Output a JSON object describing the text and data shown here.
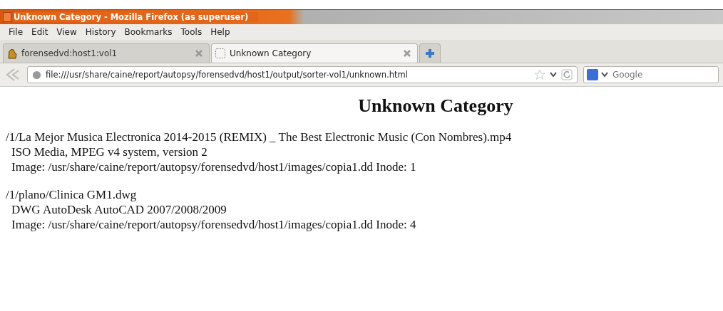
{
  "window": {
    "title": "Unknown Category - Mozilla Firefox (as superuser)"
  },
  "menu": [
    "File",
    "Edit",
    "View",
    "History",
    "Bookmarks",
    "Tools",
    "Help"
  ],
  "tabs": [
    {
      "label": "forensedvd:host1:vol1",
      "selected": false
    },
    {
      "label": "Unknown Category",
      "selected": true
    }
  ],
  "address": {
    "value": "file:///usr/share/caine/report/autopsy/forensedvd/host1/output/sorter-vol1/unknown.html"
  },
  "search": {
    "placeholder": "Google"
  },
  "page": {
    "heading": "Unknown Category",
    "entries": [
      {
        "path": "/1/La Mejor Musica Electronica 2014-2015 (REMIX) _ The Best Electronic Music (Con Nombres).mp4",
        "type": "ISO Media, MPEG v4 system, version 2",
        "image": "Image: /usr/share/caine/report/autopsy/forensedvd/host1/images/copia1.dd Inode: 1"
      },
      {
        "path": "/1/plano/Clinica GM1.dwg",
        "type": "DWG AutoDesk AutoCAD 2007/2008/2009",
        "image": "Image: /usr/share/caine/report/autopsy/forensedvd/host1/images/copia1.dd Inode: 4"
      }
    ]
  }
}
